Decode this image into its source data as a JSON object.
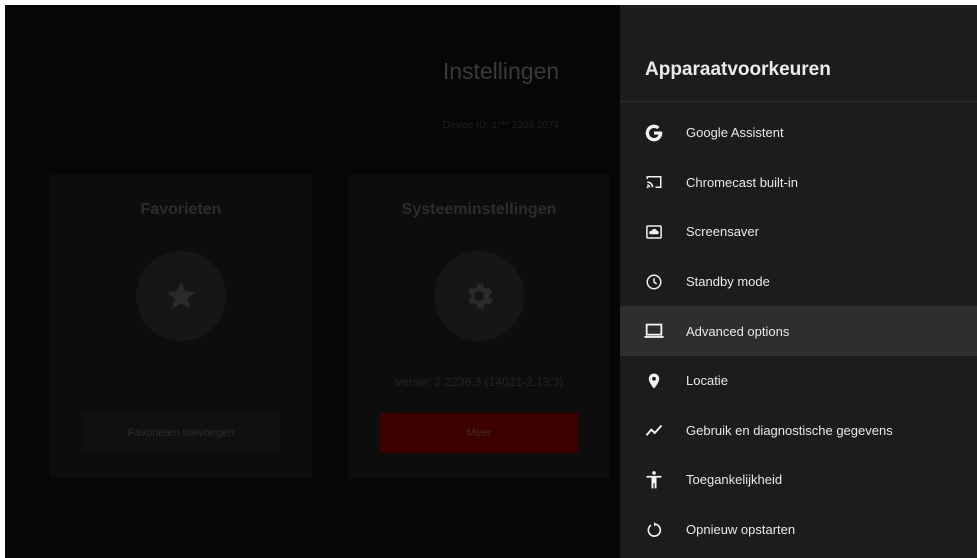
{
  "background_app": {
    "title": "Instellingen",
    "device_id": "Device ID: 1*** 2308 2074",
    "favorites_card": {
      "title": "Favorieten",
      "icon": "star-icon",
      "button_label": "Favorieten toevoegen"
    },
    "system_card": {
      "title": "Systeeminstellingen",
      "icon": "gear-icon",
      "version": "Versie: 2.2236.3 (14021-2.13.3)",
      "button_label": "Meer"
    }
  },
  "panel": {
    "title": "Apparaatvoorkeuren",
    "items": [
      {
        "label": "Google Assistent",
        "icon": "google-icon"
      },
      {
        "label": "Chromecast built-in",
        "icon": "cast-icon"
      },
      {
        "label": "Screensaver",
        "icon": "screensaver-icon"
      },
      {
        "label": "Standby mode",
        "icon": "clock-icon"
      },
      {
        "label": "Advanced options",
        "icon": "laptop-icon",
        "selected": true
      },
      {
        "label": "Locatie",
        "icon": "location-pin-icon"
      },
      {
        "label": "Gebruik en diagnostische gegevens",
        "icon": "trending-icon"
      },
      {
        "label": "Toegankelijkheid",
        "icon": "accessibility-icon"
      },
      {
        "label": "Opnieuw opstarten",
        "icon": "restart-icon"
      }
    ]
  },
  "colors": {
    "panel_bg": "#1c1c1c",
    "selected_bg": "#2e2e2e",
    "accent_red": "#3c0000"
  }
}
